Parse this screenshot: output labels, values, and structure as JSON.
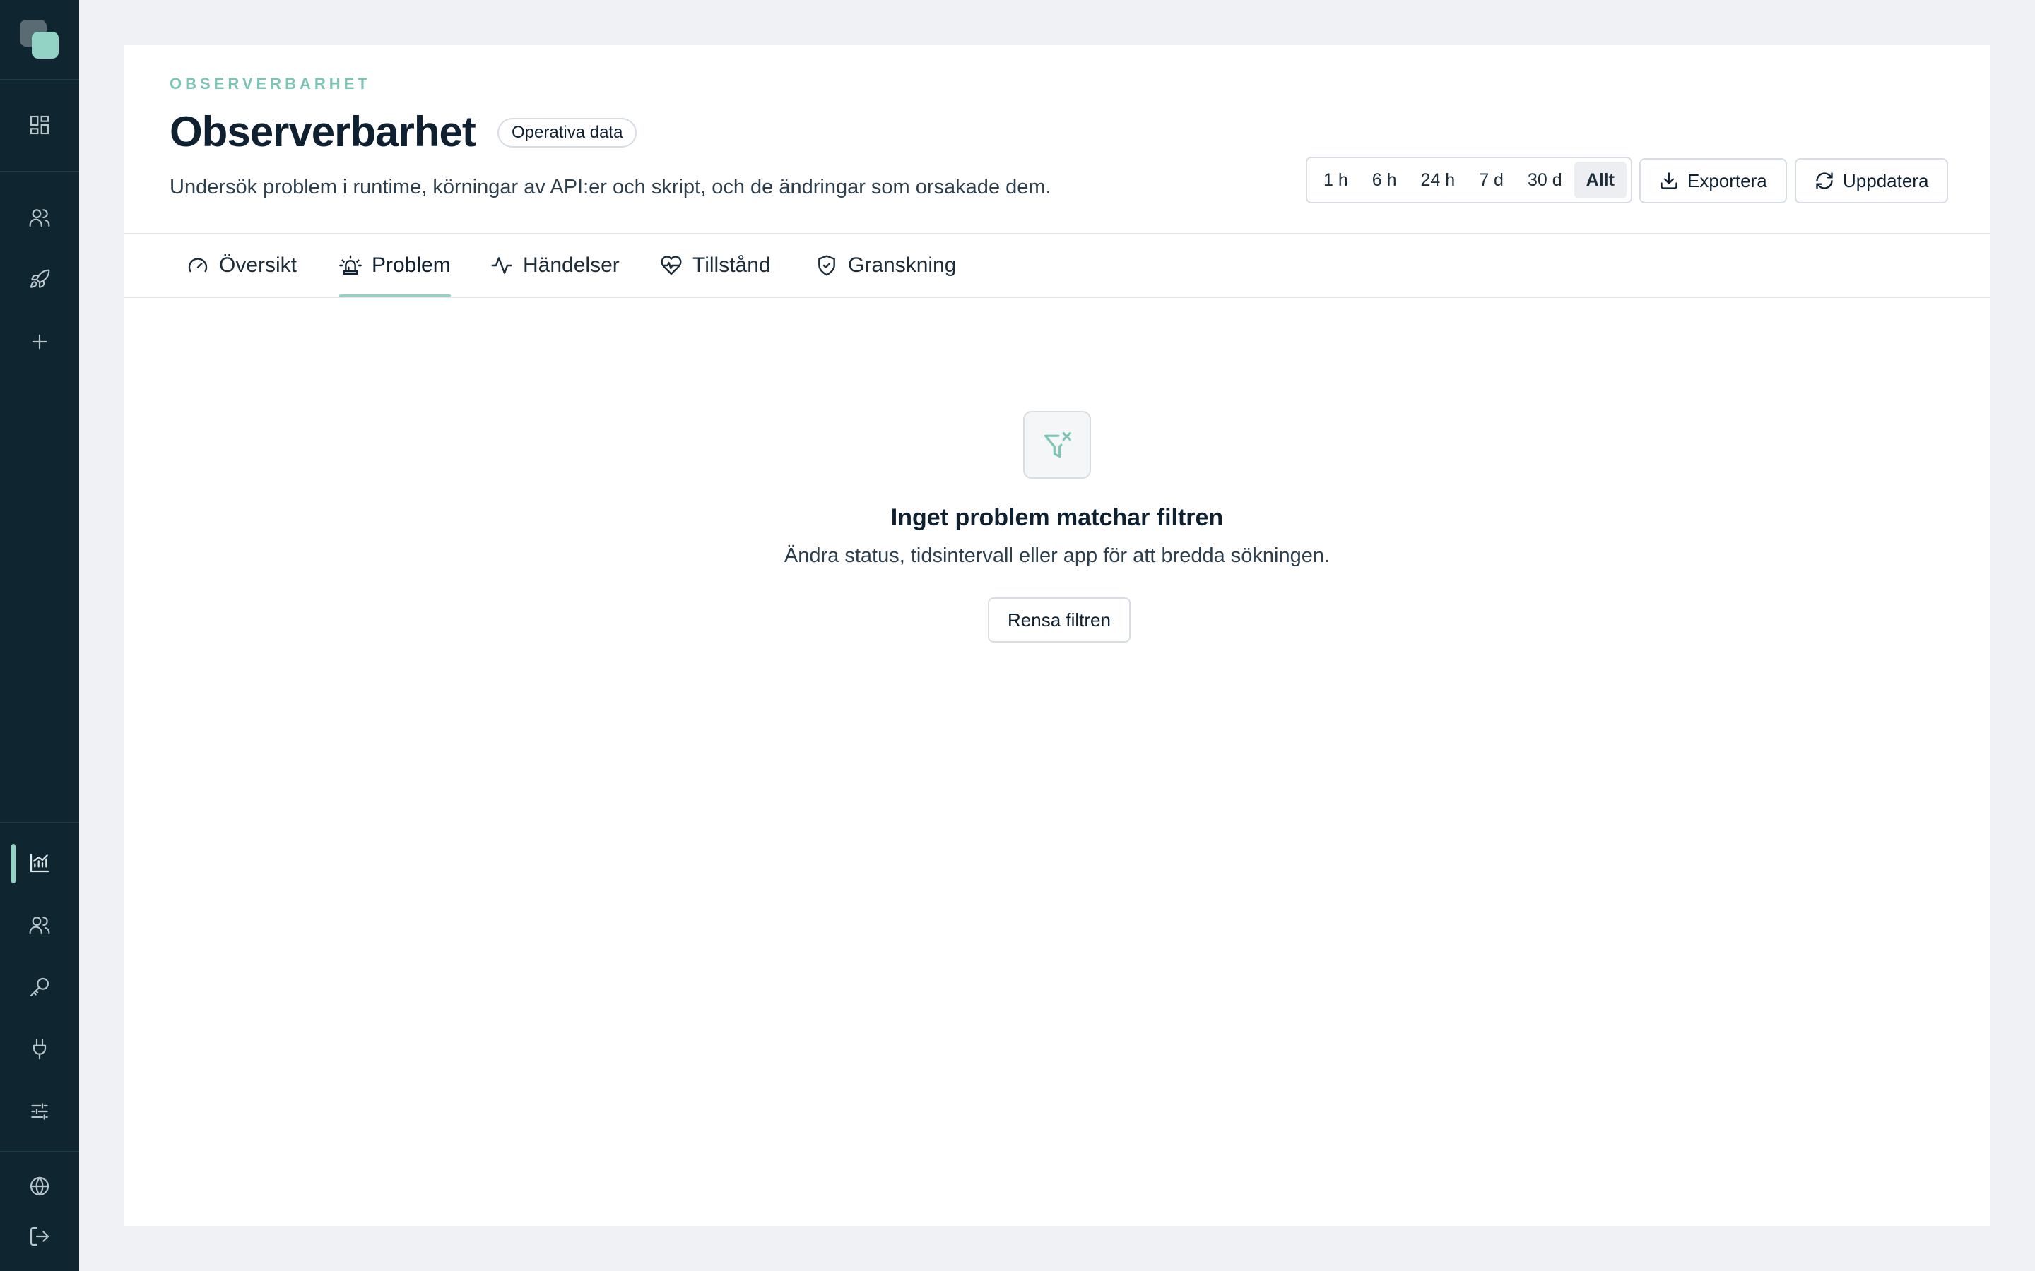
{
  "sidebar": {
    "items": [
      {
        "icon": "dashboard-icon"
      },
      {
        "icon": "users-icon"
      },
      {
        "icon": "rocket-icon"
      },
      {
        "icon": "plus-icon"
      },
      {
        "icon": "chart-icon",
        "active": true
      },
      {
        "icon": "team-icon"
      },
      {
        "icon": "key-icon"
      },
      {
        "icon": "plug-icon"
      },
      {
        "icon": "sliders-icon"
      },
      {
        "icon": "globe-icon"
      },
      {
        "icon": "logout-icon"
      }
    ],
    "accent_color": "#93d3c6"
  },
  "header": {
    "eyebrow": "OBSERVERBARHET",
    "title": "Observerbarhet",
    "badge": "Operativa data",
    "subtitle": "Undersök problem i runtime, körningar av API:er och skript, och de ändringar som orsakade dem."
  },
  "time_range": {
    "options": [
      "1 h",
      "6 h",
      "24 h",
      "7 d",
      "30 d",
      "Allt"
    ],
    "selected": "Allt"
  },
  "actions": {
    "export_label": "Exportera",
    "refresh_label": "Uppdatera"
  },
  "tabs": [
    {
      "label": "Översikt",
      "icon": "gauge-icon"
    },
    {
      "label": "Problem",
      "icon": "siren-icon",
      "active": true
    },
    {
      "label": "Händelser",
      "icon": "activity-icon"
    },
    {
      "label": "Tillstånd",
      "icon": "heart-pulse-icon"
    },
    {
      "label": "Granskning",
      "icon": "shield-check-icon"
    }
  ],
  "empty_state": {
    "icon": "filter-x-icon",
    "title": "Inget problem matchar filtren",
    "text": "Ändra status, tidsintervall eller app för att bredda sökningen.",
    "button_label": "Rensa filtren"
  }
}
